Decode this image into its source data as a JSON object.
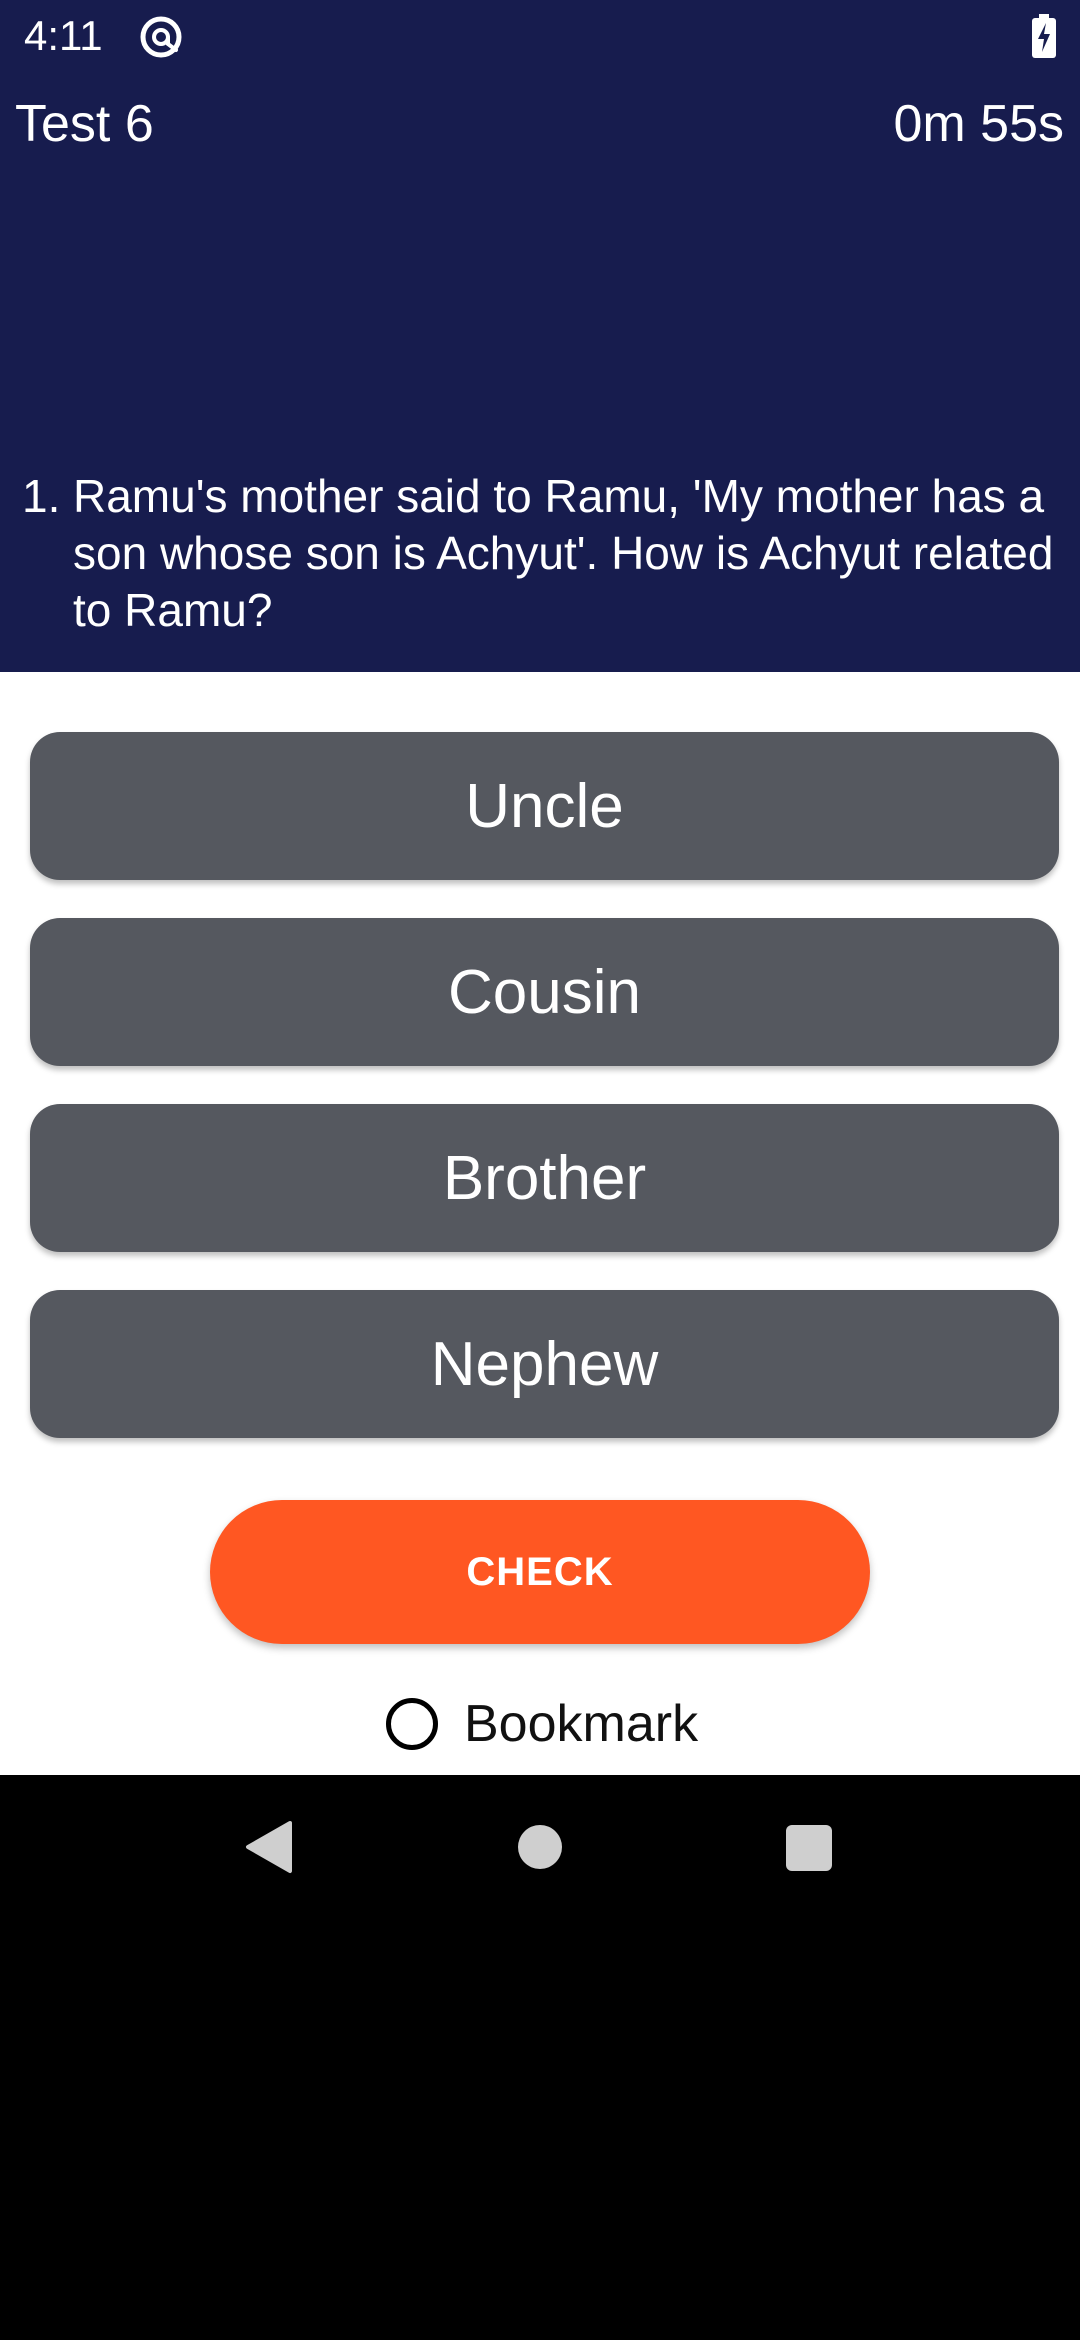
{
  "status_bar": {
    "time": "4:11",
    "app_icon": "at-sign-icon",
    "battery_icon": "battery-charging-icon"
  },
  "header": {
    "title": "Test 6",
    "timer": "0m 55s"
  },
  "question": {
    "number": "1.",
    "text": "Ramu's mother said to Ramu, 'My mother has a son whose son is Achyut'. How is Achyut related to Ramu?"
  },
  "options": [
    {
      "label": "Uncle"
    },
    {
      "label": "Cousin"
    },
    {
      "label": "Brother"
    },
    {
      "label": "Nephew"
    }
  ],
  "actions": {
    "check_label": "CHECK",
    "bookmark_label": "Bookmark",
    "bookmark_checked": false
  },
  "navbar": {
    "back_icon": "back-triangle-icon",
    "home_icon": "home-circle-icon",
    "recents_icon": "recents-square-icon"
  },
  "colors": {
    "header_bg": "#171C4E",
    "option_bg": "#55585F",
    "check_bg": "#FF5722",
    "content_bg": "#FFFFFF",
    "navbar_bg": "#000000"
  }
}
